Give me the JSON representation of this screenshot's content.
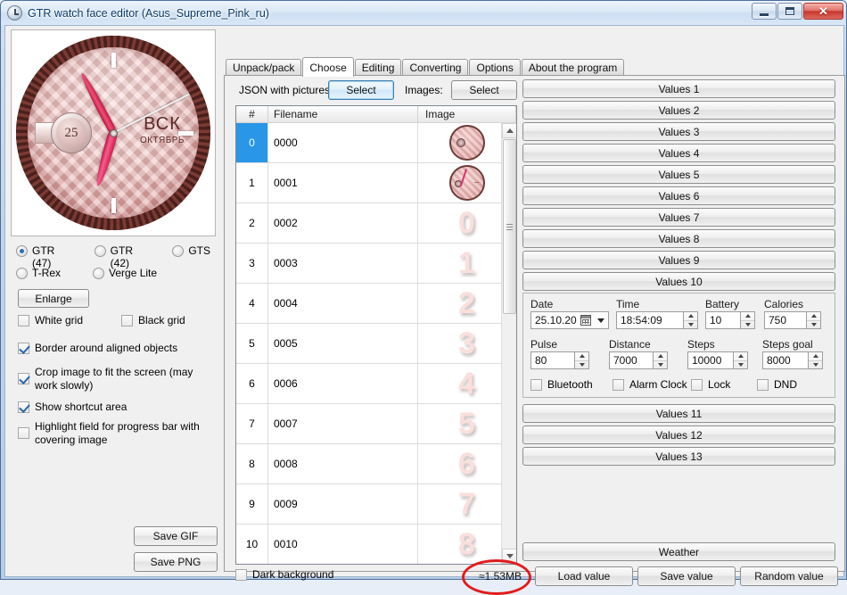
{
  "window": {
    "title": "GTR watch face editor (Asus_Supreme_Pink_ru)",
    "icon": "clock-icon",
    "minimize_label": "–",
    "maximize_label": "□",
    "close_label": "✕"
  },
  "preview": {
    "date_number": "25",
    "day_of_week": "ВСК",
    "month": "ОКТЯБРЬ"
  },
  "left_panel": {
    "device_radios": [
      {
        "label": "GTR (47)",
        "selected": true
      },
      {
        "label": "GTR (42)",
        "selected": false
      },
      {
        "label": "GTS",
        "selected": false
      },
      {
        "label": "T-Rex",
        "selected": false
      },
      {
        "label": "Verge Lite",
        "selected": false
      }
    ],
    "enlarge_button": "Enlarge",
    "checkboxes": [
      {
        "label": "White grid",
        "checked": false
      },
      {
        "label": "Black grid",
        "checked": false
      },
      {
        "label": "Border around aligned objects",
        "checked": true
      },
      {
        "label": "Crop image to fit the screen (may work slowly)",
        "checked": true
      },
      {
        "label": "Show shortcut area",
        "checked": true
      },
      {
        "label": "Highlight field for progress bar with covering image",
        "checked": false
      }
    ],
    "save_gif_button": "Save GIF",
    "save_png_button": "Save PNG"
  },
  "tabs": [
    {
      "label": "Unpack/pack",
      "active": false
    },
    {
      "label": "Choose",
      "active": true
    },
    {
      "label": "Editing",
      "active": false
    },
    {
      "label": "Converting",
      "active": false
    },
    {
      "label": "Options",
      "active": false
    },
    {
      "label": "About the program",
      "active": false
    }
  ],
  "choose_tab": {
    "json_label": "JSON with pictures:",
    "json_select_button": "Select",
    "images_label": "Images:",
    "images_select_button": "Select",
    "dark_background_checkbox": {
      "label": "Dark background",
      "checked": false
    },
    "size_label": "≈1.53MB"
  },
  "grid": {
    "columns": [
      "#",
      "Filename",
      "Image"
    ],
    "rows": [
      {
        "index": "0",
        "filename": "0000",
        "image": "watch-face-thumbnail",
        "selected": true
      },
      {
        "index": "1",
        "filename": "0001",
        "image": "watch-hands-thumbnail",
        "selected": false
      },
      {
        "index": "2",
        "filename": "0002",
        "image": "0",
        "selected": false
      },
      {
        "index": "3",
        "filename": "0003",
        "image": "1",
        "selected": false
      },
      {
        "index": "4",
        "filename": "0004",
        "image": "2",
        "selected": false
      },
      {
        "index": "5",
        "filename": "0005",
        "image": "3",
        "selected": false
      },
      {
        "index": "6",
        "filename": "0006",
        "image": "4",
        "selected": false
      },
      {
        "index": "7",
        "filename": "0007",
        "image": "5",
        "selected": false
      },
      {
        "index": "8",
        "filename": "0008",
        "image": "6",
        "selected": false
      },
      {
        "index": "9",
        "filename": "0009",
        "image": "7",
        "selected": false
      },
      {
        "index": "10",
        "filename": "0010",
        "image": "8",
        "selected": false
      }
    ]
  },
  "right_panel": {
    "values_top": [
      "Values 1",
      "Values 2",
      "Values 3",
      "Values 4",
      "Values 5",
      "Values 6",
      "Values 7",
      "Values 8",
      "Values 9",
      "Values 10"
    ],
    "values_bottom": [
      "Values 11",
      "Values 12",
      "Values 13"
    ],
    "weather_button": "Weather",
    "fields": {
      "date": {
        "label": "Date",
        "value": "25.10.2020"
      },
      "time": {
        "label": "Time",
        "value": "18:54:09"
      },
      "battery": {
        "label": "Battery",
        "value": "10"
      },
      "calories": {
        "label": "Calories",
        "value": "750"
      },
      "pulse": {
        "label": "Pulse",
        "value": "80"
      },
      "distance": {
        "label": "Distance",
        "value": "7000"
      },
      "steps": {
        "label": "Steps",
        "value": "10000"
      },
      "steps_goal": {
        "label": "Steps goal",
        "value": "8000"
      }
    },
    "toggles": [
      {
        "label": "Bluetooth",
        "checked": false
      },
      {
        "label": "Alarm Clock",
        "checked": false
      },
      {
        "label": "Lock",
        "checked": false
      },
      {
        "label": "DND",
        "checked": false
      }
    ],
    "load_value_button": "Load value",
    "save_value_button": "Save value",
    "random_value_button": "Random value"
  },
  "colors": {
    "selection": "#2a96e8",
    "annotation": "#e21b1b",
    "title_text": "#0b3a68"
  }
}
